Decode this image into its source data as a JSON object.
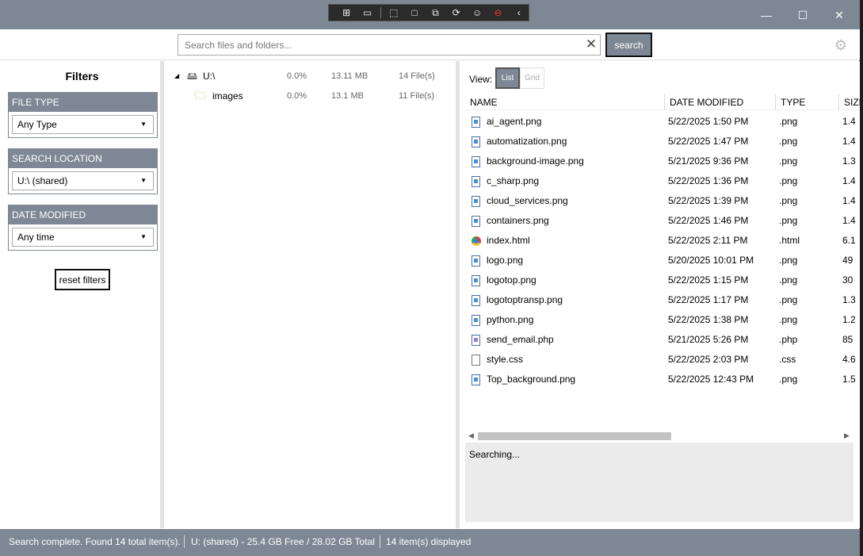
{
  "search": {
    "placeholder": "Search files and folders...",
    "clear_icon": "close-icon",
    "button_label": "search"
  },
  "filters": {
    "title": "Filters",
    "groups": [
      {
        "header": "FILE TYPE",
        "value": "Any Type"
      },
      {
        "header": "SEARCH LOCATION",
        "value": "U:\\ (shared)"
      },
      {
        "header": "DATE MODIFIED",
        "value": "Any time"
      }
    ],
    "reset_label": "reset filters"
  },
  "tree": [
    {
      "name": "U:\\",
      "percent": "0.0%",
      "size": "13.11 MB",
      "count": "14 File(s)",
      "icon": "drive-icon"
    },
    {
      "name": "images",
      "percent": "0.0%",
      "size": "13.1 MB",
      "count": "11 File(s)",
      "icon": "folder-icon"
    }
  ],
  "view": {
    "label": "View:",
    "list_label": "List",
    "grid_label": "Grid"
  },
  "columns": {
    "name": "NAME",
    "date": "DATE MODIFIED",
    "type": "TYPE",
    "size": "SIZE"
  },
  "files": [
    {
      "name": "ai_agent.png",
      "date": "5/22/2025 1:50 PM",
      "type": ".png",
      "size": "1.4",
      "icon": "image"
    },
    {
      "name": "automatization.png",
      "date": "5/22/2025 1:47 PM",
      "type": ".png",
      "size": "1.4",
      "icon": "image"
    },
    {
      "name": "background-image.png",
      "date": "5/21/2025 9:36 PM",
      "type": ".png",
      "size": "1.3",
      "icon": "image"
    },
    {
      "name": "c_sharp.png",
      "date": "5/22/2025 1:36 PM",
      "type": ".png",
      "size": "1.4",
      "icon": "image"
    },
    {
      "name": "cloud_services.png",
      "date": "5/22/2025 1:39 PM",
      "type": ".png",
      "size": "1.4",
      "icon": "image"
    },
    {
      "name": "containers.png",
      "date": "5/22/2025 1:46 PM",
      "type": ".png",
      "size": "1.4",
      "icon": "image"
    },
    {
      "name": "index.html",
      "date": "5/22/2025 2:11 PM",
      "type": ".html",
      "size": "6.1",
      "icon": "html"
    },
    {
      "name": "logo.png",
      "date": "5/20/2025 10:01 PM",
      "type": ".png",
      "size": "49",
      "icon": "image"
    },
    {
      "name": "logotop.png",
      "date": "5/22/2025 1:15 PM",
      "type": ".png",
      "size": "30",
      "icon": "image"
    },
    {
      "name": "logotoptransp.png",
      "date": "5/22/2025 1:17 PM",
      "type": ".png",
      "size": "1.3",
      "icon": "image"
    },
    {
      "name": "python.png",
      "date": "5/22/2025 1:38 PM",
      "type": ".png",
      "size": "1.2",
      "icon": "image"
    },
    {
      "name": "send_email.php",
      "date": "5/21/2025 5:26 PM",
      "type": ".php",
      "size": "85",
      "icon": "php"
    },
    {
      "name": "style.css",
      "date": "5/22/2025 2:03 PM",
      "type": ".css",
      "size": "4.6",
      "icon": "doc"
    },
    {
      "name": "Top_background.png",
      "date": "5/22/2025 12:43 PM",
      "type": ".png",
      "size": "1.5",
      "icon": "image"
    }
  ],
  "details": {
    "text": "Searching..."
  },
  "statusbar": {
    "message": "Search complete. Found 14 total item(s).",
    "drive": "U: (shared) - 25.4 GB Free / 28.02 GB Total",
    "displayed": "14 item(s) displayed"
  },
  "colors": {
    "accent": "#7d8894",
    "pane_divider": "#e2e2e2"
  }
}
